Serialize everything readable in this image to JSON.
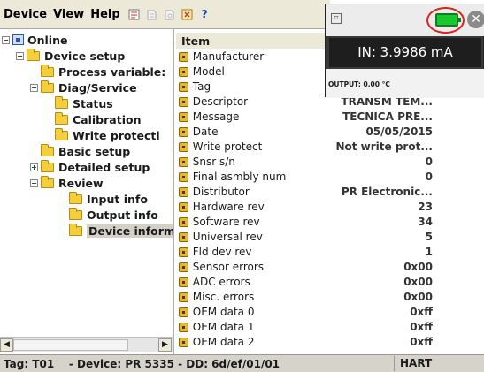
{
  "menu": {
    "device": "Device",
    "view": "View",
    "help": "Help"
  },
  "toolbar": {
    "icons": [
      "toolbar-icon-a",
      "toolbar-icon-b",
      "toolbar-icon-c",
      "toolbar-icon-d",
      "help-icon"
    ],
    "help_glyph": "?"
  },
  "tree": {
    "root": "Online",
    "device_setup": "Device setup",
    "process_variables": "Process variable:",
    "diag_service": "Diag/Service",
    "status": "Status",
    "calibration": "Calibration",
    "write_protect": "Write protecti",
    "basic_setup": "Basic setup",
    "detailed_setup": "Detailed setup",
    "review": "Review",
    "input_info": "Input info",
    "output_info": "Output info",
    "device_info": "Device inform"
  },
  "list": {
    "header": "Item",
    "rows": [
      {
        "name": "Manufacturer",
        "value": ""
      },
      {
        "name": "Model",
        "value": ""
      },
      {
        "name": "Tag",
        "value": ""
      },
      {
        "name": "Descriptor",
        "value": "TRANSM TEM..."
      },
      {
        "name": "Message",
        "value": "TECNICA PRE..."
      },
      {
        "name": "Date",
        "value": "05/05/2015"
      },
      {
        "name": "Write protect",
        "value": "Not write prot..."
      },
      {
        "name": "Snsr s/n",
        "value": "0"
      },
      {
        "name": "Final asmbly num",
        "value": "0"
      },
      {
        "name": "Distributor",
        "value": "PR Electronic..."
      },
      {
        "name": "Hardware rev",
        "value": "23"
      },
      {
        "name": "Software rev",
        "value": "34"
      },
      {
        "name": "Universal rev",
        "value": "5"
      },
      {
        "name": "Fld dev rev",
        "value": "1"
      },
      {
        "name": "Sensor errors",
        "value": "0x00"
      },
      {
        "name": "ADC errors",
        "value": "0x00"
      },
      {
        "name": "Misc. errors",
        "value": "0x00"
      },
      {
        "name": "OEM data 0",
        "value": "0xff"
      },
      {
        "name": "OEM data 1",
        "value": "0xff"
      },
      {
        "name": "OEM data 2",
        "value": "0xff"
      }
    ]
  },
  "overlay": {
    "main_reading": "IN: 3.9986 mA",
    "output_reading": "OUTPUT: 0.00 °C",
    "battery_color": "#19c82e",
    "highlight_color": "#e02020",
    "close_glyph": "✕",
    "small_icon_glyph": "⌗"
  },
  "status": {
    "text": "Tag: T01    - Device: PR 5335 - DD: 6d/ef/01/01",
    "protocol": "HART"
  }
}
